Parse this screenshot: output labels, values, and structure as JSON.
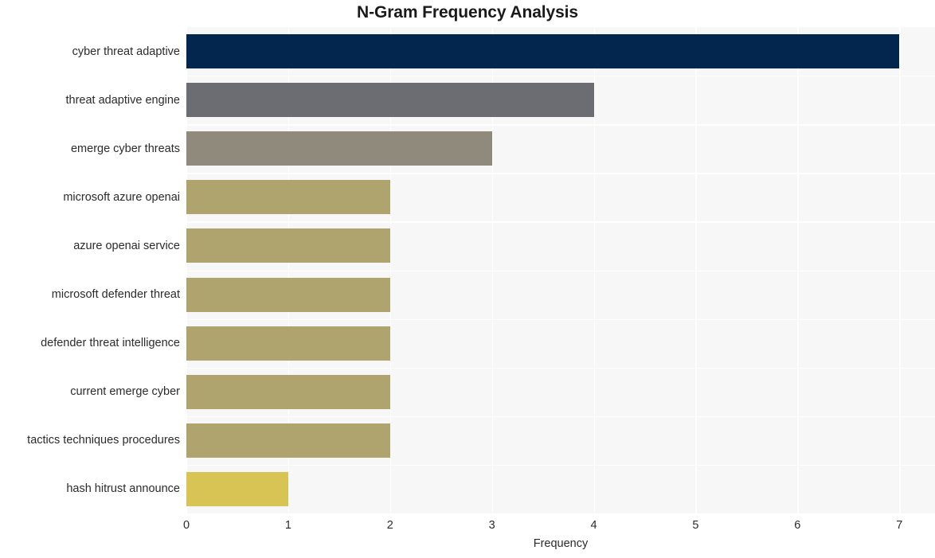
{
  "chart_data": {
    "type": "bar",
    "orientation": "horizontal",
    "title": "N-Gram Frequency Analysis",
    "xlabel": "Frequency",
    "ylabel": "",
    "xlim": [
      0,
      7.35
    ],
    "xticks": [
      0,
      1,
      2,
      3,
      4,
      5,
      6,
      7
    ],
    "xtick_labels": [
      "0",
      "1",
      "2",
      "3",
      "4",
      "5",
      "6",
      "7"
    ],
    "grid": true,
    "legend": null,
    "categories": [
      "cyber threat adaptive",
      "threat adaptive engine",
      "emerge cyber threats",
      "microsoft azure openai",
      "azure openai service",
      "microsoft defender threat",
      "defender threat intelligence",
      "current emerge cyber",
      "tactics techniques procedures",
      "hash hitrust announce"
    ],
    "values": [
      7,
      4,
      3,
      2,
      2,
      2,
      2,
      2,
      2,
      1
    ],
    "bar_colors": [
      "#03264f",
      "#6c6d73",
      "#908a7c",
      "#b0a46e",
      "#b0a46e",
      "#b0a46e",
      "#b0a46e",
      "#b0a46e",
      "#b0a46e",
      "#d8c355"
    ],
    "plot_background": "#f7f7f7",
    "grid_color": "#ffffff",
    "figure_background": "#ffffff"
  }
}
